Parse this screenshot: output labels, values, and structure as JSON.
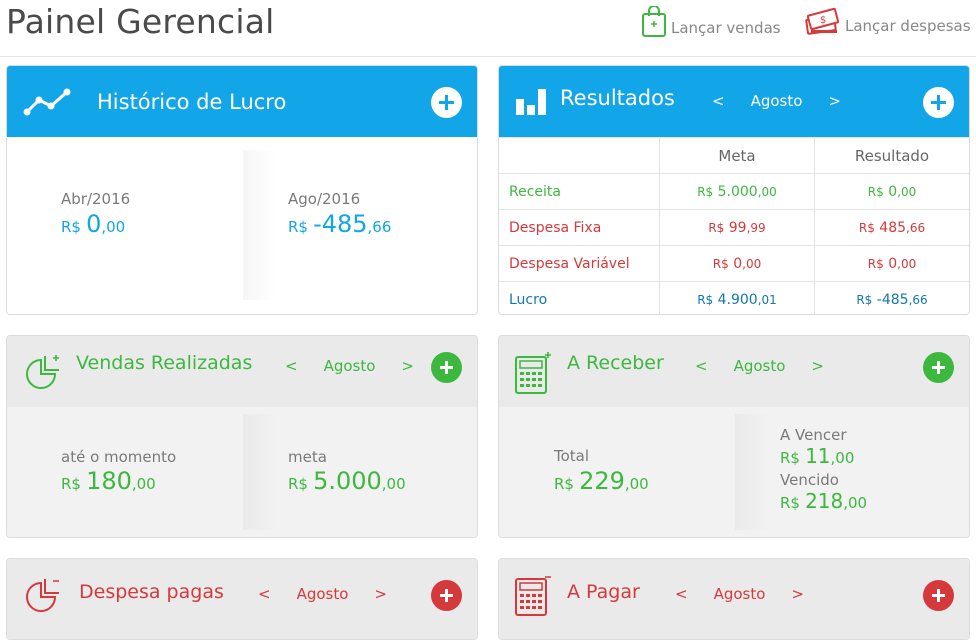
{
  "header": {
    "title": "Painel Gerencial",
    "actions": [
      {
        "label": "Lançar vendas",
        "icon": "shopping-bag-icon"
      },
      {
        "label": "Lançar despesas",
        "icon": "money-cash-icon"
      }
    ]
  },
  "colors": {
    "blue": "#12a5e8",
    "green": "#3db83f",
    "red": "#d6393b",
    "darkblue": "#1478b0"
  },
  "historico": {
    "title": "Histórico de Lucro",
    "icon": "line-chart-icon",
    "left": {
      "period": "Abr/2016",
      "currency": "R$",
      "int": "0",
      "dec": ",00"
    },
    "right": {
      "period": "Ago/2016",
      "currency": "R$",
      "int": "-485",
      "dec": ",66"
    }
  },
  "resultados": {
    "title": "Resultados",
    "icon": "bar-chart-icon",
    "prev": "<",
    "month": "Agosto",
    "next": ">",
    "columns": [
      "",
      "Meta",
      "Resultado"
    ],
    "rows": [
      {
        "label": "Receita",
        "meta_cur": "R$",
        "meta_int": "5.000",
        "meta_dec": ",00",
        "res_cur": "R$",
        "res_int": "0",
        "res_dec": ",00"
      },
      {
        "label": "Despesa Fixa",
        "meta_cur": "R$",
        "meta_int": "99",
        "meta_dec": ",99",
        "res_cur": "R$",
        "res_int": "485",
        "res_dec": ",66"
      },
      {
        "label": "Despesa Variável",
        "meta_cur": "R$",
        "meta_int": "0",
        "meta_dec": ",00",
        "res_cur": "R$",
        "res_int": "0",
        "res_dec": ",00"
      },
      {
        "label": "Lucro",
        "meta_cur": "R$",
        "meta_int": "4.900",
        "meta_dec": ",01",
        "res_cur": "R$",
        "res_int": "-485",
        "res_dec": ",66"
      }
    ]
  },
  "vendas": {
    "title": "Vendas Realizadas",
    "icon": "pie-chart-icon",
    "prev": "<",
    "month": "Agosto",
    "next": ">",
    "left": {
      "label": "até o momento",
      "currency": "R$",
      "int": "180",
      "dec": ",00"
    },
    "right": {
      "label": "meta",
      "currency": "R$",
      "int": "5.000",
      "dec": ",00"
    }
  },
  "receber": {
    "title": "A Receber",
    "icon": "calculator-icon",
    "prev": "<",
    "month": "Agosto",
    "next": ">",
    "total": {
      "label": "Total",
      "currency": "R$",
      "int": "229",
      "dec": ",00"
    },
    "vencer": {
      "label": "A Vencer",
      "currency": "R$",
      "int": "11",
      "dec": ",00"
    },
    "vencido": {
      "label": "Vencido",
      "currency": "R$",
      "int": "218",
      "dec": ",00"
    }
  },
  "despesas": {
    "title": "Despesa pagas",
    "icon": "pie-chart-icon",
    "prev": "<",
    "month": "Agosto",
    "next": ">"
  },
  "pagar": {
    "title": "A Pagar",
    "icon": "calculator-icon",
    "prev": "<",
    "month": "Agosto",
    "next": ">"
  }
}
